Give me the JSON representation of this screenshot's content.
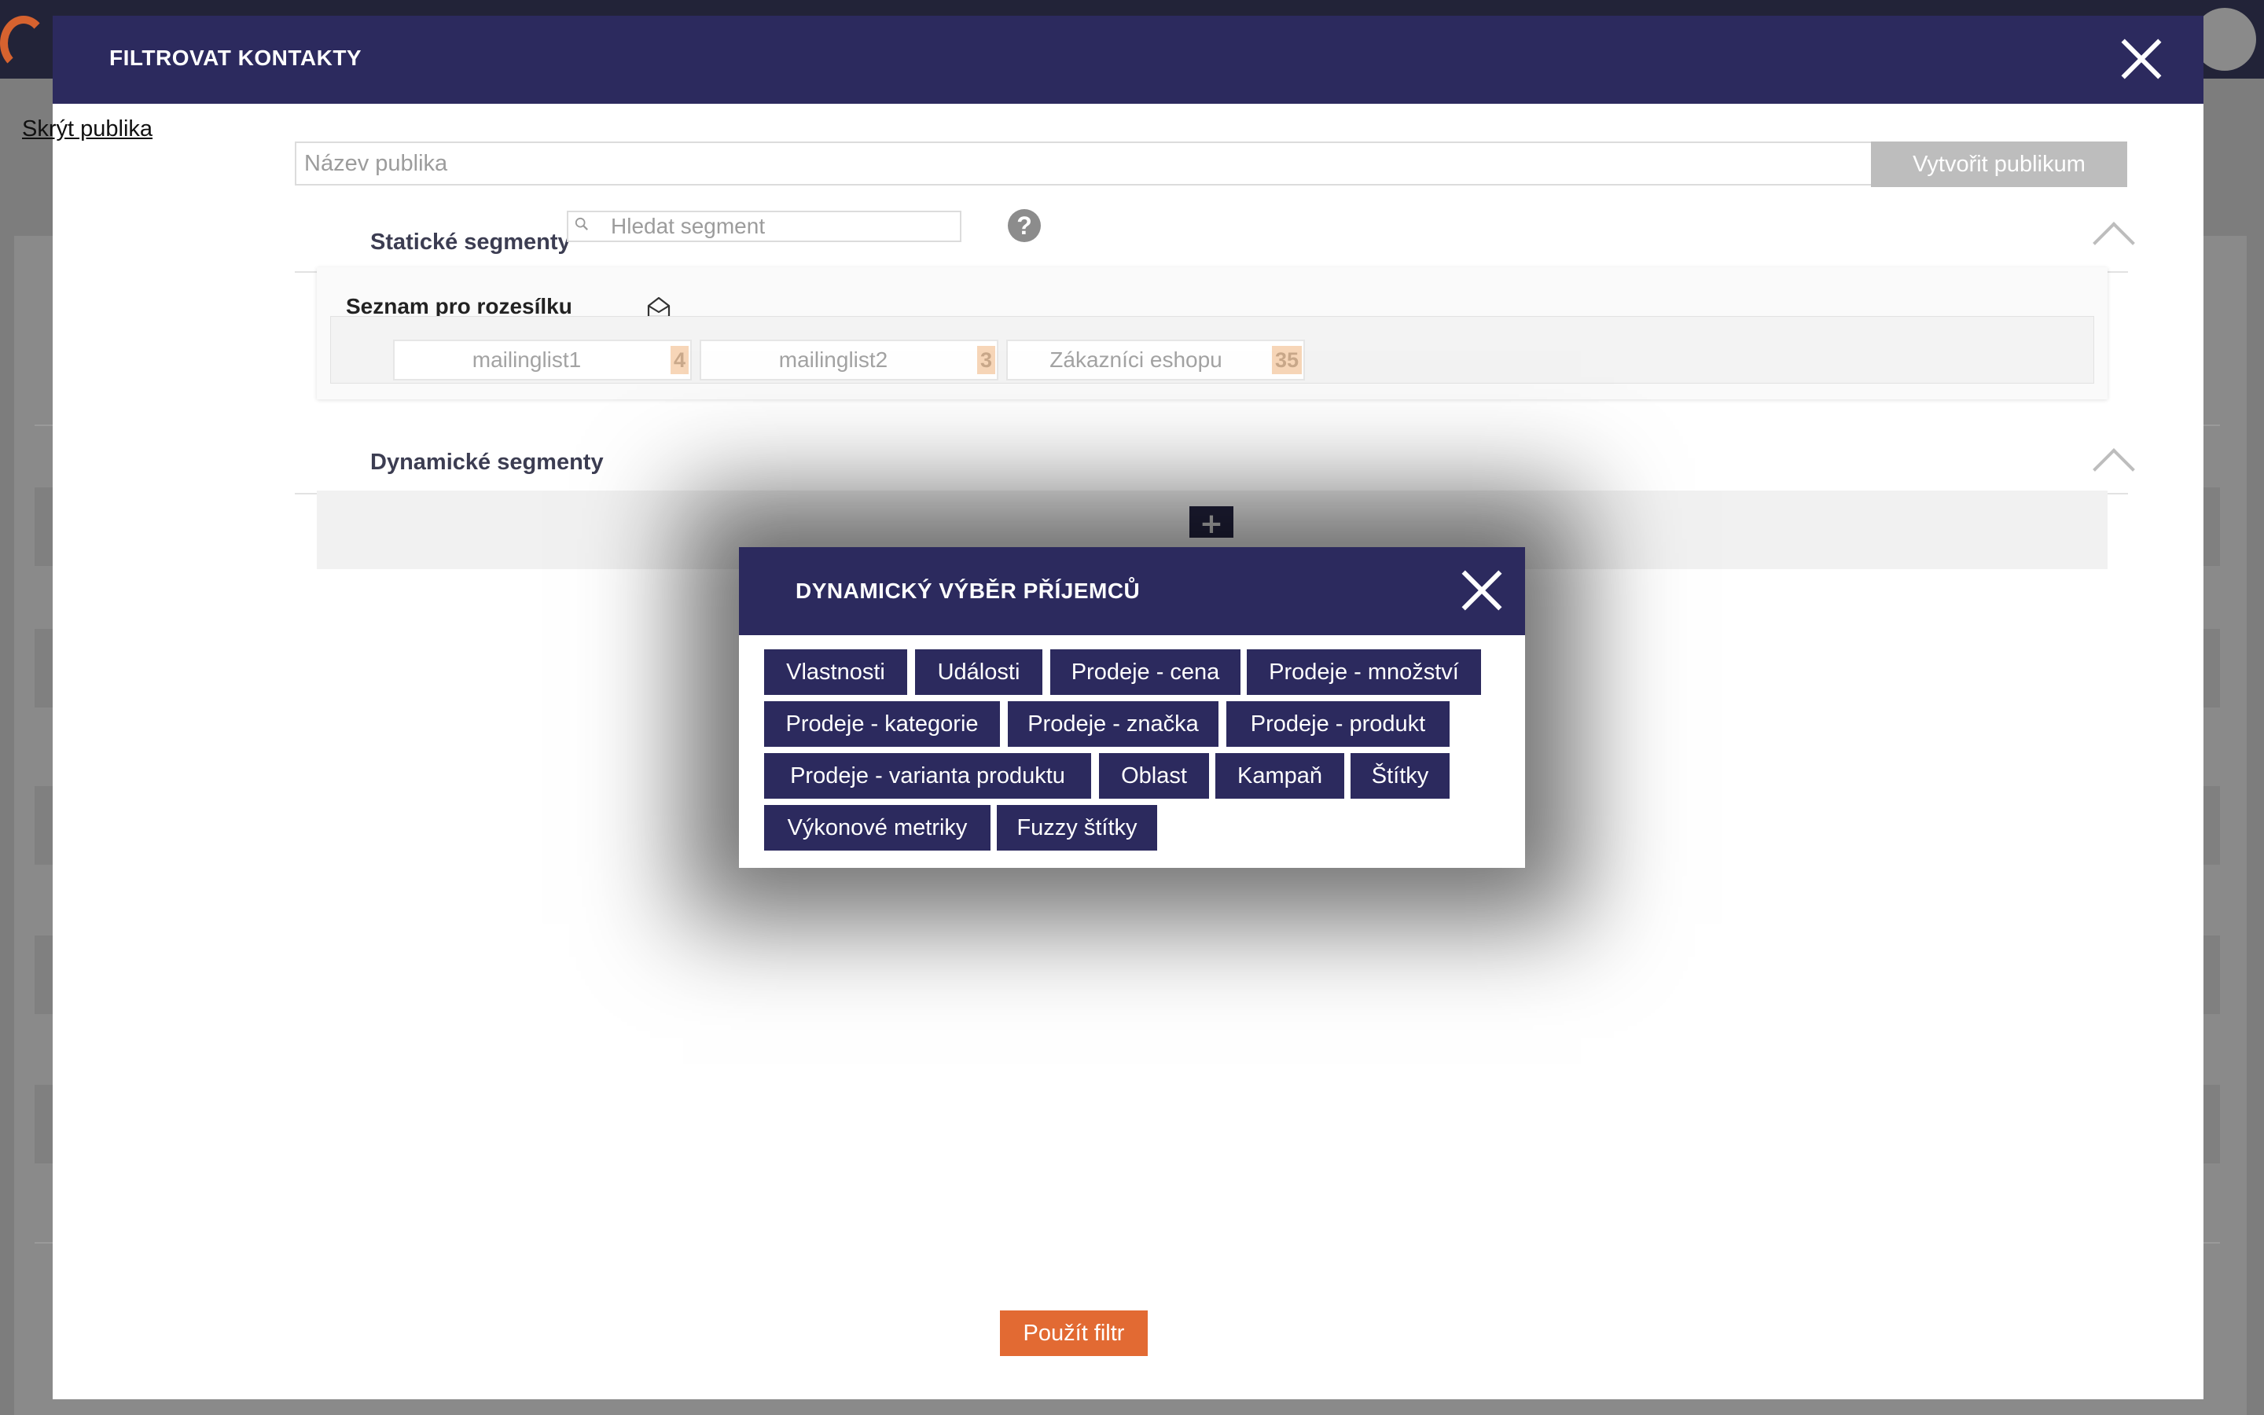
{
  "modal": {
    "title": "FILTROVAT KONTAKTY",
    "hide_link": "Skrýt publika",
    "audience_name_placeholder": "Název publika",
    "create_button": "Vytvořit publikum",
    "apply_button": "Použít filtr"
  },
  "static_segments": {
    "title": "Statické segmenty",
    "search_placeholder": "Hledat segment",
    "help": "?",
    "list_title": "Seznam pro rozesílku",
    "lists": [
      {
        "name": "mailinglist1",
        "count": "4"
      },
      {
        "name": "mailinglist2",
        "count": "3"
      },
      {
        "name": "Zákazníci eshopu",
        "count": "35"
      }
    ]
  },
  "dynamic_segments": {
    "title": "Dynamické segmenty",
    "add": "+"
  },
  "dialog": {
    "title": "DYNAMICKÝ VÝBĚR PŘÍJEMCŮ",
    "categories": [
      "Vlastnosti",
      "Události",
      "Prodeje - cena",
      "Prodeje - množství",
      "Prodeje - kategorie",
      "Prodeje - značka",
      "Prodeje - produkt",
      "Prodeje - varianta produktu",
      "Oblast",
      "Kampaň",
      "Štítky",
      "Výkonové metriky",
      "Fuzzy štítky"
    ]
  },
  "colors": {
    "header": "#2c2a5e",
    "accent": "#e26a33",
    "badge": "#f7d6b8"
  }
}
